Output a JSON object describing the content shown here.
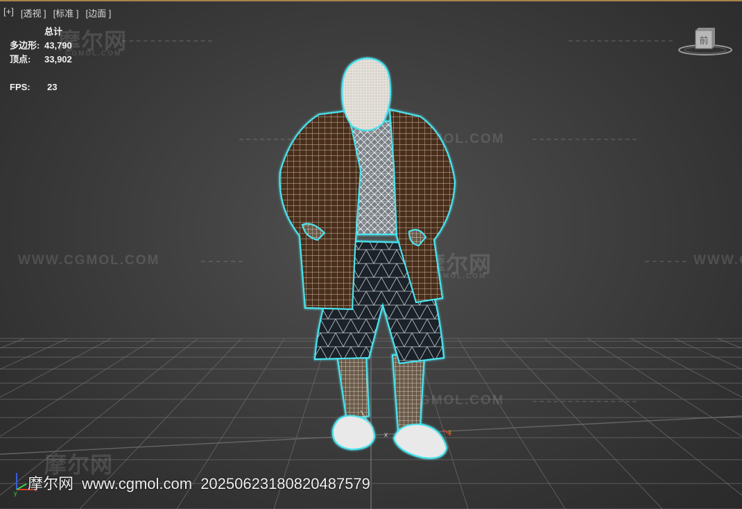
{
  "menu": {
    "plus": "[+]",
    "perspective": "[透视 ]",
    "standard": "[标准 ]",
    "edged_faces": "[边面 ]"
  },
  "stats": {
    "header": "总计",
    "polygons_label": "多边形:",
    "polygons_value": "43,790",
    "vertices_label": "顶点:",
    "vertices_value": "33,902",
    "fps_label": "FPS:",
    "fps_value": "23"
  },
  "viewcube": {
    "face_label": "前"
  },
  "watermarks": {
    "url": "WWW.CGMOL.COM",
    "url_partial": "GMOL.COM",
    "brand": "摩尔网",
    "brand_small": "CGMOL.COM"
  },
  "axis": {
    "x": "x",
    "y": "y"
  },
  "caption": {
    "brand": "摩尔网",
    "url": "www.cgmol.com",
    "id": "20250623180820487579"
  },
  "colors": {
    "viewport_bg": "#3e3e3e",
    "grid_line": "#6f6f6f",
    "wire_jacket": "#e8d9c2",
    "jacket_fill": "#4a2e1c",
    "selection_glow": "#49e3ee",
    "axis_red": "#e03a2c",
    "axis_blue": "#3a5de0",
    "axis_green": "#3ad04a"
  },
  "icons": [
    "viewcube-icon",
    "axis-gizmo-icon"
  ]
}
